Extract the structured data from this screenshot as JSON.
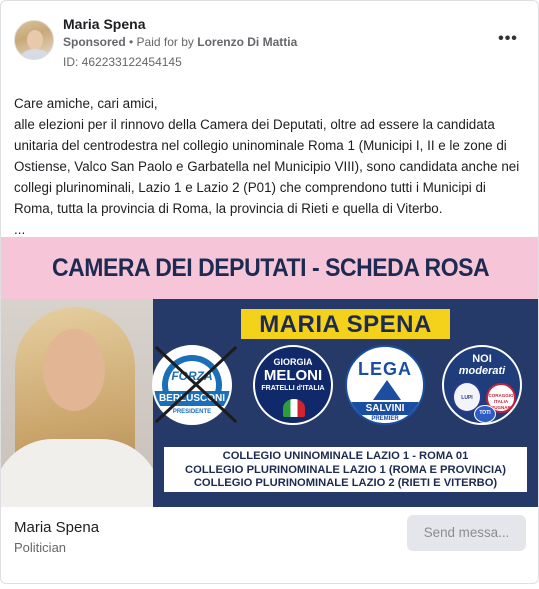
{
  "header": {
    "advertiser_name": "Maria Spena",
    "sponsored": "Sponsored",
    "separator": " • ",
    "paid_for_prefix": "Paid for by ",
    "paid_for_by": "Lorenzo Di Mattia",
    "ad_id": "ID: 462233122454145",
    "more_label": "•••"
  },
  "post": {
    "line1": "Care amiche, cari amici,",
    "paragraph": "alle elezioni per il rinnovo della Camera dei Deputati, oltre ad essere la candidata unitaria del centrodestra nel collegio uninominale Roma 1 (Municipi I, II e le zone di Ostiense, Valco San Paolo e Garbatella nel Municipio VIII), sono candidata anche nei collegi plurinominali, Lazio 1 e Lazio 2 (P01) che comprendono tutti i Municipi di Roma, tutta la provincia di Roma, la provincia di Rieti e quella di Viterbo.",
    "ellipsis": "..."
  },
  "creative": {
    "headline": "CAMERA DEI DEPUTATI - SCHEDA ROSA",
    "candidate": "MARIA SPENA",
    "logos": {
      "forza_italia": {
        "top": "FORZA",
        "main": "BERLUSCONI",
        "sub": "PRESIDENTE"
      },
      "fratelli_italia": {
        "top": "GIORGIA",
        "main": "MELONI",
        "sub": "FRATELLI d'ITALIA"
      },
      "lega": {
        "main": "LEGA",
        "sub": "SALVINI",
        "small": "PREMIER"
      },
      "noi_moderati": {
        "top": "NOI",
        "main": "moderati",
        "b1": "LUPI",
        "b2": "CORAGGIO ITALIA BRUGNARO",
        "b3": "TOTI"
      }
    },
    "colleges": [
      "COLLEGIO UNINOMINALE LAZIO 1 - ROMA 01",
      "COLLEGIO PLURINOMINALE LAZIO 1 (ROMA E PROVINCIA)",
      "COLLEGIO PLURINOMINALE LAZIO 2 (RIETI E VITERBO)"
    ],
    "colors": {
      "pink": "#f7c5d8",
      "navy": "#253a68",
      "yellow": "#f4d11a"
    }
  },
  "footer": {
    "page_name": "Maria Spena",
    "category": "Politician",
    "send_button": "Send messa..."
  }
}
